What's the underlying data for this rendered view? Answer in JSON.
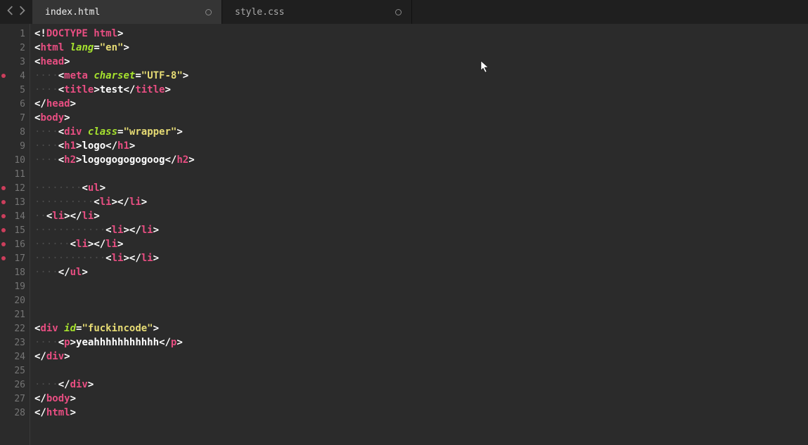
{
  "tabs": {
    "t0": {
      "label": "index.html",
      "modified": true,
      "active": true
    },
    "t1": {
      "label": "style.css",
      "modified": true,
      "active": false
    }
  },
  "gutter": {
    "modified_lines": [
      4,
      12,
      13,
      14,
      15,
      16,
      17
    ],
    "total": 28
  },
  "code": {
    "l1": {
      "indent": "",
      "kind": "doctype",
      "raw": "<!DOCTYPE html>"
    },
    "l2": {
      "indent": "",
      "kind": "open",
      "tag": "html",
      "attr": "lang",
      "val": "\"en\""
    },
    "l3": {
      "indent": "",
      "kind": "open",
      "tag": "head"
    },
    "l4": {
      "indent": "····",
      "kind": "selfclose",
      "tag": "meta",
      "attr": "charset",
      "val": "\"UTF-8\""
    },
    "l5": {
      "indent": "····",
      "kind": "wrap",
      "tag": "title",
      "text": "test"
    },
    "l6": {
      "indent": "",
      "kind": "close",
      "tag": "head"
    },
    "l7": {
      "indent": "",
      "kind": "open",
      "tag": "body"
    },
    "l8": {
      "indent": "····",
      "kind": "open",
      "tag": "div",
      "attr": "class",
      "val": "\"wrapper\""
    },
    "l9": {
      "indent": "····",
      "kind": "wrap",
      "tag": "h1",
      "text": "logo"
    },
    "l10": {
      "indent": "····",
      "kind": "wrap",
      "tag": "h2",
      "text": "logogogogogoog"
    },
    "l11": {
      "indent": "",
      "kind": "blank"
    },
    "l12": {
      "indent": "········",
      "kind": "open",
      "tag": "ul"
    },
    "l13": {
      "indent": "··········",
      "kind": "wrap",
      "tag": "li",
      "text": ""
    },
    "l14": {
      "indent": "··",
      "kind": "wrap",
      "tag": "li",
      "text": ""
    },
    "l15": {
      "indent": "············",
      "kind": "wrap",
      "tag": "li",
      "text": ""
    },
    "l16": {
      "indent": "······",
      "kind": "wrap",
      "tag": "li",
      "text": ""
    },
    "l17": {
      "indent": "············",
      "kind": "wrap",
      "tag": "li",
      "text": ""
    },
    "l18": {
      "indent": "····",
      "kind": "close",
      "tag": "ul"
    },
    "l19": {
      "indent": "",
      "kind": "blank"
    },
    "l20": {
      "indent": "",
      "kind": "blank"
    },
    "l21": {
      "indent": "",
      "kind": "blank"
    },
    "l22": {
      "indent": "",
      "kind": "open",
      "tag": "div",
      "attr": "id",
      "val": "\"fuckincode\""
    },
    "l23": {
      "indent": "····",
      "kind": "wrap",
      "tag": "p",
      "text": "yeahhhhhhhhhhh"
    },
    "l24": {
      "indent": "",
      "kind": "close",
      "tag": "div"
    },
    "l25": {
      "indent": "",
      "kind": "blank"
    },
    "l26": {
      "indent": "····",
      "kind": "close",
      "tag": "div"
    },
    "l27": {
      "indent": "",
      "kind": "close",
      "tag": "body"
    },
    "l28": {
      "indent": "",
      "kind": "close",
      "tag": "html"
    }
  }
}
